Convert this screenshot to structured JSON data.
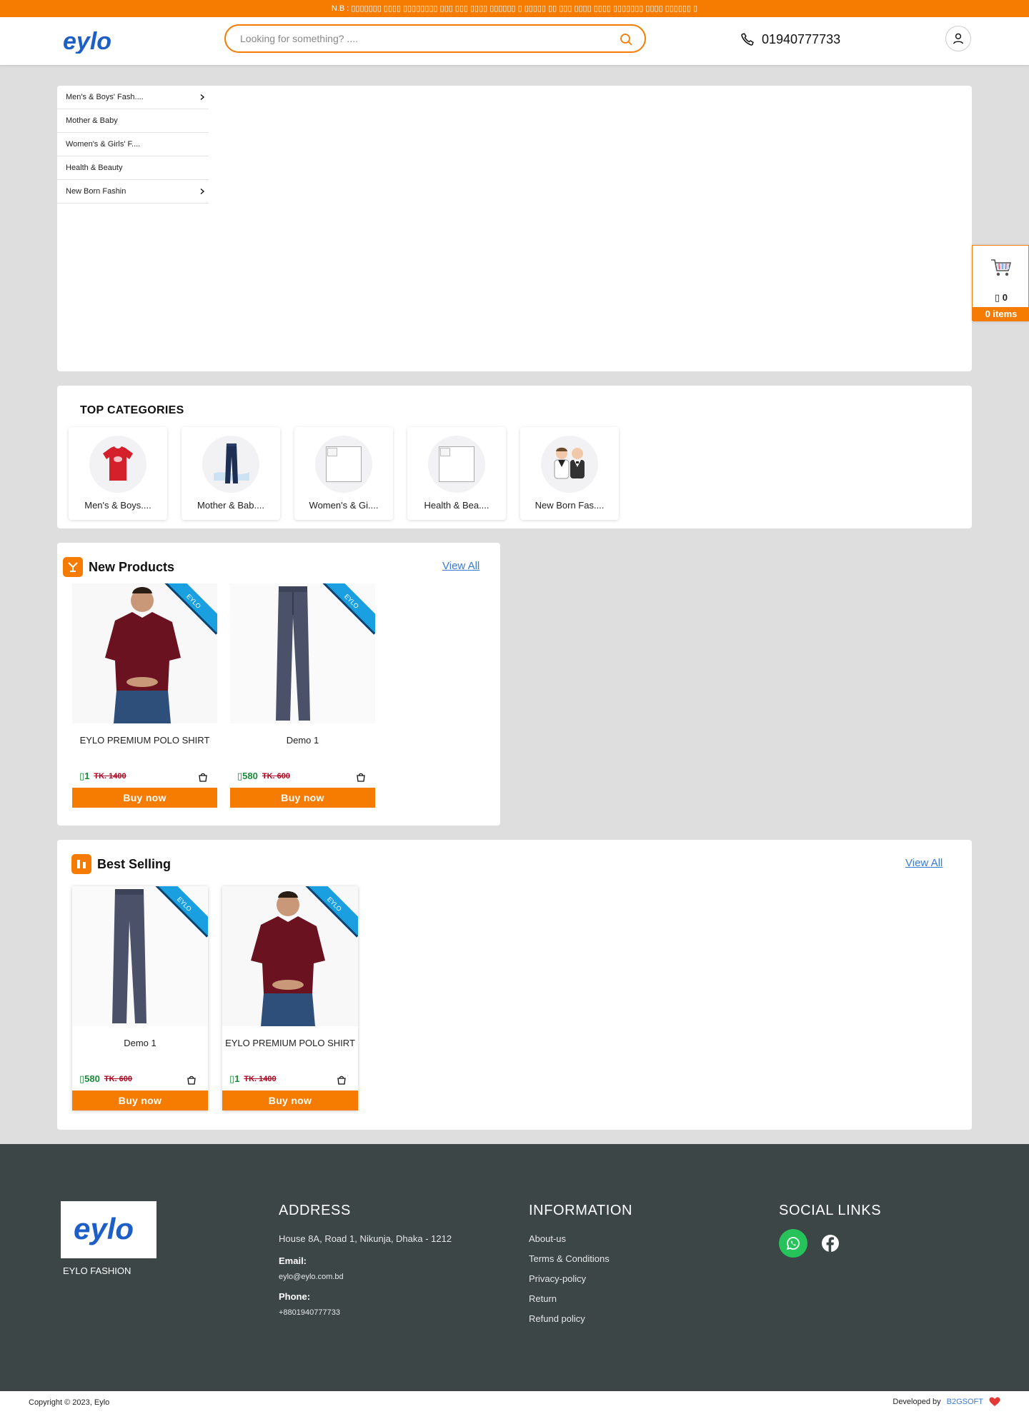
{
  "notice": "N.B : ▯▯▯▯▯▯▯ ▯▯▯▯ ▯▯▯▯▯▯▯▯ ▯▯▯ ▯▯▯ ▯▯▯▯ ▯▯▯▯▯▯ ▯ ▯▯▯▯▯ ▯▯ ▯▯▯ ▯▯▯▯ ▯▯▯▯ ▯▯▯▯▯▯▯ ▯▯▯▯ ▯▯▯▯▯▯ ▯",
  "header": {
    "logo_text": "eylo",
    "search_placeholder": "Looking for something? ....",
    "phone": "01940777733"
  },
  "categories": [
    {
      "label": "Men's & Boys' Fash....",
      "has_sub": true
    },
    {
      "label": "Mother & Baby",
      "has_sub": false
    },
    {
      "label": "Women's & Girls' F....",
      "has_sub": false
    },
    {
      "label": "Health & Beauty",
      "has_sub": false
    },
    {
      "label": "New Born Fashin",
      "has_sub": true
    }
  ],
  "floating_cart": {
    "amount": "▯ 0",
    "items": "0 items"
  },
  "top_categories": {
    "title": "TOP CATEGORIES",
    "items": [
      {
        "label": "Men's & Boys....",
        "image": "tshirt"
      },
      {
        "label": "Mother & Bab....",
        "image": "jeans"
      },
      {
        "label": "Women's & Gi....",
        "image": "broken"
      },
      {
        "label": "Health & Bea....",
        "image": "broken"
      },
      {
        "label": "New Born Fas....",
        "image": "babies"
      }
    ]
  },
  "new_products": {
    "title": "New Products",
    "view_all": "View All",
    "products": [
      {
        "name": "EYLO PREMIUM POLO SHIRT",
        "price": "▯1",
        "old_price": "TK. 1400",
        "buy": "Buy now",
        "ribbon": "EYLO",
        "image": "polo"
      },
      {
        "name": "Demo 1",
        "price": "▯580",
        "old_price": "TK. 600",
        "buy": "Buy now",
        "ribbon": "EYLO",
        "image": "pants"
      }
    ]
  },
  "best_selling": {
    "title": "Best Selling",
    "view_all": "View All",
    "products": [
      {
        "name": "Demo 1",
        "price": "▯580",
        "old_price": "TK. 600",
        "buy": "Buy now",
        "ribbon": "EYLO",
        "image": "pants"
      },
      {
        "name": "EYLO PREMIUM POLO SHIRT",
        "price": "▯1",
        "old_price": "TK. 1400",
        "buy": "Buy now",
        "ribbon": "EYLO",
        "image": "polo"
      }
    ]
  },
  "footer": {
    "brand": "EYLO FASHION",
    "address": {
      "title": "ADDRESS",
      "line": "House 8A, Road 1, Nikunja, Dhaka - 1212",
      "email_label": "Email:",
      "email": "eylo@eylo.com.bd",
      "phone_label": "Phone:",
      "phone": "+8801940777733"
    },
    "information": {
      "title": "INFORMATION",
      "links": [
        "About-us",
        "Terms & Conditions",
        "Privacy-policy",
        "Return",
        "Refund policy"
      ]
    },
    "social": {
      "title": "SOCIAL LINKS",
      "icons": [
        "whatsapp-icon",
        "facebook-icon"
      ]
    }
  },
  "bottom": {
    "copyright": "Copyright © 2023, Eylo",
    "developed_by": "Developed by",
    "developer": "B2GSOFT"
  },
  "colors": {
    "accent": "#f57c00",
    "price_green": "#1a8a3a",
    "old_price_red": "#b00020",
    "link_blue": "#3a7bd5",
    "footer_bg": "#3d4647",
    "ribbon_blue": "#1aa0e0"
  }
}
